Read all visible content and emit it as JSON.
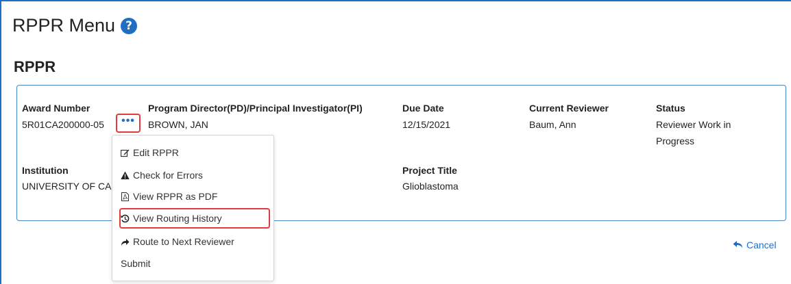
{
  "page": {
    "title": "RPPR Menu",
    "help_icon": "question-circle-icon",
    "section_title": "RPPR"
  },
  "record": {
    "award_number_label": "Award Number",
    "award_number": "5R01CA200000-05",
    "pd_pi_label": "Program Director(PD)/Principal Investigator(PI)",
    "pd_pi": "BROWN, JAN",
    "due_date_label": "Due Date",
    "due_date": "12/15/2021",
    "current_reviewer_label": "Current Reviewer",
    "current_reviewer": "Baum, Ann",
    "status_label": "Status",
    "status_line1": "Reviewer Work in",
    "status_line2": "Progress",
    "institution_label": "Institution",
    "institution": "UNIVERSITY OF CA",
    "project_title_label": "Project Title",
    "project_title": "Glioblastoma"
  },
  "actions_button": {
    "label": "•••",
    "icon": "ellipsis-icon"
  },
  "menu": {
    "items": [
      {
        "label": "Edit RPPR",
        "icon": "edit-icon"
      },
      {
        "label": "Check for Errors",
        "icon": "warning-icon"
      },
      {
        "label": "View RPPR as PDF",
        "icon": "pdf-file-icon"
      },
      {
        "label": "View Routing History",
        "icon": "history-icon",
        "highlighted": true
      },
      {
        "label": "Route to Next Reviewer",
        "icon": "share-arrow-icon"
      },
      {
        "label": "Submit",
        "icon": ""
      }
    ]
  },
  "cancel": {
    "label": "Cancel",
    "icon": "reply-arrow-icon"
  },
  "colors": {
    "accent": "#1e6fc4",
    "highlight": "#e03b3b",
    "panel_border": "#4a86c5"
  }
}
